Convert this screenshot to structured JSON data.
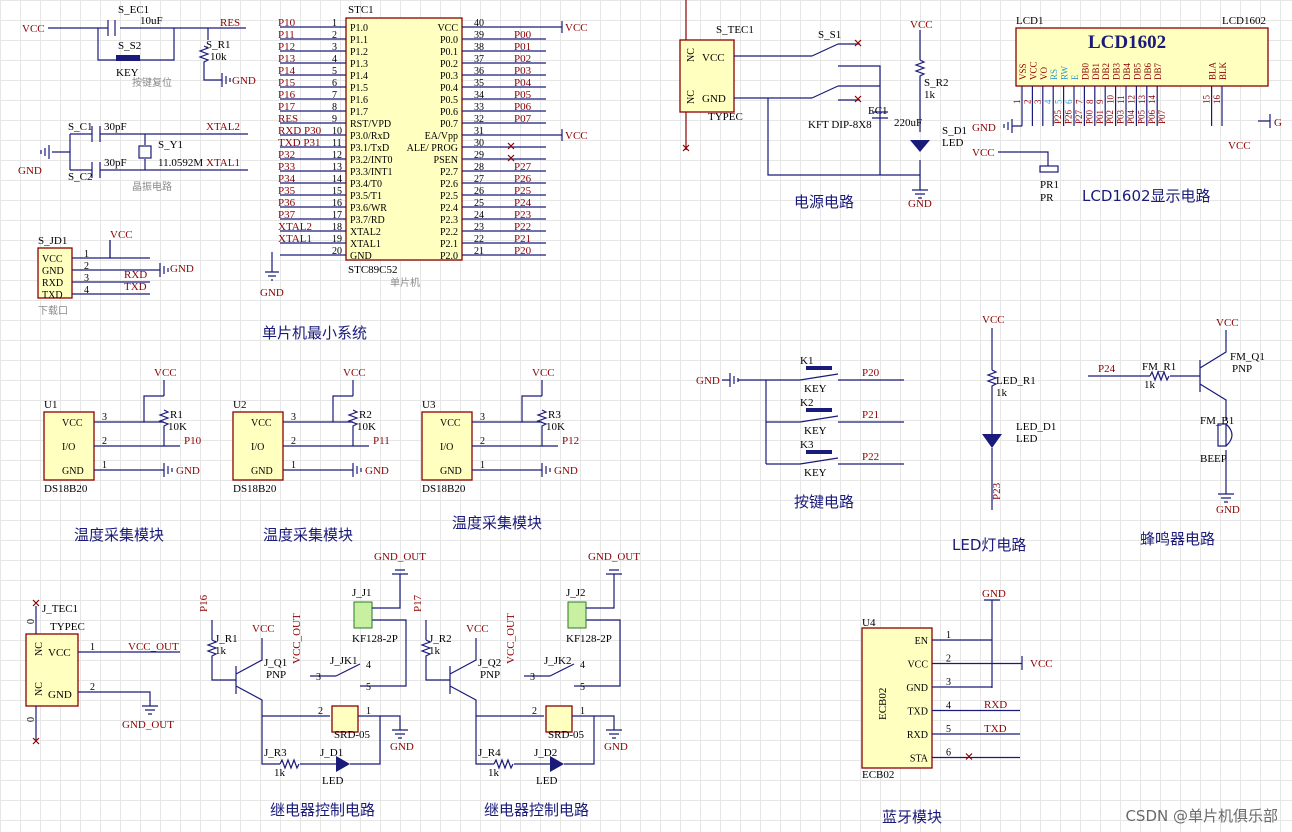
{
  "titles": {
    "mcu": "单片机最小系统",
    "temp1": "温度采集模块",
    "temp2": "温度采集模块",
    "temp3": "温度采集模块",
    "relay1": "继电器控制电路",
    "relay2": "继电器控制电路",
    "power": "电源电路",
    "lcd": "LCD1602显示电路",
    "keys": "按键电路",
    "led": "LED灯电路",
    "buzzer": "蜂鸣器电路",
    "bt": "蓝牙模块"
  },
  "mcu": {
    "ref": "STC1",
    "part": "STC89C52",
    "sub": "单片机",
    "left_nets": [
      "P10",
      "P11",
      "P12",
      "P13",
      "P14",
      "P15",
      "P16",
      "P17",
      "RES",
      "RXD P30",
      "TXD P31",
      "P32",
      "P33",
      "P34",
      "P35",
      "P36",
      "P37",
      "XTAL2",
      "XTAL1"
    ],
    "left_pins": [
      "P1.0",
      "P1.1",
      "P1.2",
      "P1.3",
      "P1.4",
      "P1.5",
      "P1.6",
      "P1.7",
      "RST/VPD",
      "P3.0/RxD",
      "P3.1/TxD",
      "P3.2/INT0",
      "P3.3/INT1",
      "P3.4/T0",
      "P3.5/T1",
      "P3.6/WR",
      "P3.7/RD",
      "XTAL2",
      "XTAL1",
      "GND"
    ],
    "left_nums": [
      "1",
      "2",
      "3",
      "4",
      "5",
      "6",
      "7",
      "8",
      "9",
      "10",
      "11",
      "12",
      "13",
      "14",
      "15",
      "16",
      "17",
      "18",
      "19",
      "20"
    ],
    "right_pins": [
      "VCC",
      "P0.0",
      "P0.1",
      "P0.2",
      "P0.3",
      "P0.4",
      "P0.5",
      "P0.6",
      "P0.7",
      "EA/Vpp",
      "ALE/ PROG",
      "PSEN",
      "P2.7",
      "P2.6",
      "P2.5",
      "P2.4",
      "P2.3",
      "P2.2",
      "P2.1",
      "P2.0"
    ],
    "right_nums": [
      "40",
      "39",
      "38",
      "37",
      "36",
      "35",
      "34",
      "33",
      "32",
      "31",
      "30",
      "29",
      "28",
      "27",
      "26",
      "25",
      "24",
      "23",
      "22",
      "21"
    ],
    "right_nets": [
      "VCC",
      "P00",
      "P01",
      "P02",
      "P03",
      "P04",
      "P05",
      "P06",
      "P07",
      "VCC",
      "",
      "",
      "P27",
      "P26",
      "P25",
      "P24",
      "P23",
      "P22",
      "P21",
      "P20"
    ],
    "gnd": "GND"
  },
  "reset": {
    "vcc": "VCC",
    "cap_ref": "S_EC1",
    "cap_val": "10uF",
    "sw_ref": "S_S2",
    "sw_val": "KEY",
    "res_net": "RES",
    "r_ref": "S_R1",
    "r_val": "10k",
    "gnd": "GND",
    "caption": "按键复位"
  },
  "crystal": {
    "c1_ref": "S_C1",
    "c1_val": "30pF",
    "c2_ref": "S_C2",
    "c2_val": "30pF",
    "y_ref": "S_Y1",
    "y_val": "11.0592M",
    "x2": "XTAL2",
    "x1": "XTAL1",
    "gnd": "GND",
    "caption": "晶振电路"
  },
  "header": {
    "ref": "S_JD1",
    "pins": [
      "VCC",
      "GND",
      "RXD",
      "TXD"
    ],
    "nums": [
      "1",
      "2",
      "3",
      "4"
    ],
    "vcc": "VCC",
    "rxd": "RXD",
    "txd": "TXD",
    "gnd": "GND",
    "caption": "下载口"
  },
  "ds18b20": [
    {
      "ref": "U1",
      "r": "R1",
      "rv": "10K",
      "net": "P10",
      "vcc": "VCC",
      "gnd": "GND",
      "part": "DS18B20"
    },
    {
      "ref": "U2",
      "r": "R2",
      "rv": "10K",
      "net": "P11",
      "vcc": "VCC",
      "gnd": "GND",
      "part": "DS18B20"
    },
    {
      "ref": "U3",
      "r": "R3",
      "rv": "10K",
      "net": "P12",
      "vcc": "VCC",
      "gnd": "GND",
      "part": "DS18B20"
    }
  ],
  "ds_pins": [
    "VCC",
    "I/O",
    "GND"
  ],
  "ds_nums": [
    "3",
    "2",
    "1"
  ],
  "jtec": {
    "ref": "J_TEC1",
    "val": "TYPEC",
    "nc": "NC",
    "vcc": "VCC",
    "gnd": "GND",
    "vcc_out": "VCC_OUT",
    "gnd_out": "GND_OUT",
    "n1": "1",
    "n2": "2",
    "z": "0"
  },
  "relays": [
    {
      "net": "P16",
      "rref": "J_R1",
      "rv": "1k",
      "q": "J_Q1",
      "qt": "PNP",
      "vccout": "VCC_OUT",
      "vcc": "VCC",
      "jk": "J_JK1",
      "part": "SRD-05",
      "j": "J_J1",
      "jp": "KF128-2P",
      "gndout": "GND_OUT",
      "r3": "J_R3",
      "r3v": "1k",
      "d": "J_D1",
      "dv": "LED",
      "gnd": "GND"
    },
    {
      "net": "P17",
      "rref": "J_R2",
      "rv": "1k",
      "q": "J_Q2",
      "qt": "PNP",
      "vccout": "VCC_OUT",
      "vcc": "VCC",
      "jk": "J_JK2",
      "part": "SRD-05",
      "j": "J_J2",
      "jp": "KF128-2P",
      "gndout": "GND_OUT",
      "r3": "J_R4",
      "r3v": "1k",
      "d": "J_D2",
      "dv": "LED",
      "gnd": "GND"
    }
  ],
  "power": {
    "ref": "S_TEC1",
    "val": "TYPEC",
    "nc": "NC",
    "vcc": "VCC",
    "gnd": "GND",
    "sw": "S_S1",
    "sw_val": "KFT DIP-8X8",
    "r": "S_R2",
    "rv": "1k",
    "ec": "S_EC1",
    "ecv": "220uF",
    "d": "S_D1",
    "dv": "LED",
    "ecshort": "EC1"
  },
  "lcd": {
    "ref": "LCD1",
    "name": "LCD1602",
    "label": "LCD1602",
    "pins": [
      "VSS",
      "VCC",
      "VO",
      "RS",
      "RW",
      "E",
      "DB0",
      "DB1",
      "DB2",
      "DB3",
      "DB4",
      "DB5",
      "DB6",
      "DB7",
      "BLA",
      "BLK"
    ],
    "nums": [
      "1",
      "2",
      "3",
      "4",
      "5",
      "6",
      "7",
      "8",
      "9",
      "10",
      "11",
      "12",
      "13",
      "14",
      "15",
      "16"
    ],
    "nets": [
      "",
      "",
      "",
      "P25",
      "P26",
      "P27",
      "P00",
      "P01",
      "P02",
      "P03",
      "P04",
      "P05",
      "P06",
      "P07",
      "",
      ""
    ],
    "gnd": "GND",
    "vcc": "VCC",
    "pr": "PR1",
    "prv": "PR",
    "g": "G"
  },
  "keys": {
    "gnd": "GND",
    "items": [
      {
        "ref": "K1",
        "val": "KEY",
        "net": "P20"
      },
      {
        "ref": "K2",
        "val": "KEY",
        "net": "P21"
      },
      {
        "ref": "K3",
        "val": "KEY",
        "net": "P22"
      }
    ]
  },
  "ledc": {
    "vcc": "VCC",
    "r": "LED_R1",
    "rv": "1k",
    "d": "LED_D1",
    "dv": "LED",
    "net": "P23"
  },
  "buzzer": {
    "vcc": "VCC",
    "net": "P24",
    "r": "FM_R1",
    "rv": "1k",
    "q": "FM_Q1",
    "qt": "PNP",
    "b": "FM_B1",
    "bv": "BEEP",
    "gnd": "GND"
  },
  "bt": {
    "ref": "U4",
    "part": "ECB02",
    "label": "ECB02",
    "pins": [
      "EN",
      "VCC",
      "GND",
      "TXD",
      "RXD",
      "STA"
    ],
    "nums": [
      "1",
      "2",
      "3",
      "4",
      "5",
      "6"
    ],
    "gnd": "GND",
    "vcc": "VCC",
    "rxd": "RXD",
    "txd": "TXD"
  },
  "watermark": "CSDN @单片机俱乐部"
}
